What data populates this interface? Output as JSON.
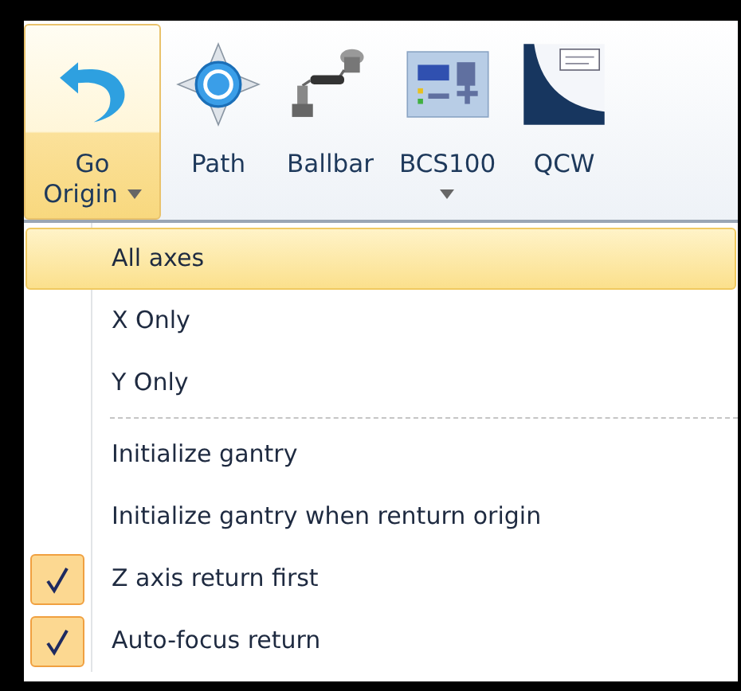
{
  "ribbon": {
    "buttons": [
      {
        "label": "Go Origin",
        "selected": true,
        "dropdown": true
      },
      {
        "label": "Path",
        "selected": false,
        "dropdown": false
      },
      {
        "label": "Ballbar",
        "selected": false,
        "dropdown": false
      },
      {
        "label": "BCS100",
        "selected": false,
        "dropdown": true
      },
      {
        "label": "QCW",
        "selected": false,
        "dropdown": false
      }
    ]
  },
  "menu": {
    "items": [
      {
        "kind": "item",
        "label": "All axes",
        "selected": true,
        "checked": false
      },
      {
        "kind": "item",
        "label": "X Only",
        "selected": false,
        "checked": false
      },
      {
        "kind": "item",
        "label": "Y Only",
        "selected": false,
        "checked": false
      },
      {
        "kind": "separator"
      },
      {
        "kind": "item",
        "label": "Initialize gantry",
        "selected": false,
        "checked": false
      },
      {
        "kind": "item",
        "label": "Initialize gantry when renturn origin",
        "selected": false,
        "checked": false
      },
      {
        "kind": "item",
        "label": "Z axis return first",
        "selected": false,
        "checked": true
      },
      {
        "kind": "item",
        "label": "Auto-focus return",
        "selected": false,
        "checked": true
      }
    ]
  }
}
